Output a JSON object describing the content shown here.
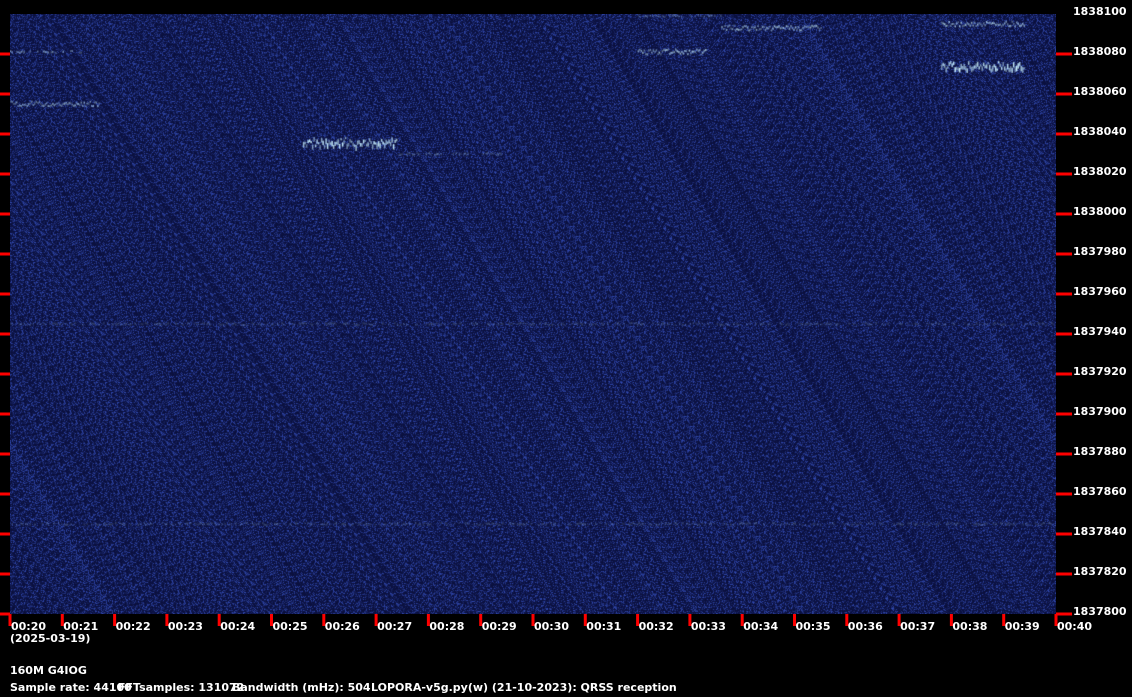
{
  "colors": {
    "background": "#000000",
    "plot_bg": "#0a0f3c",
    "tick_red": "#ff0000",
    "signal": "#c8f0ff"
  },
  "y_axis": {
    "unit": "Hz",
    "labels": [
      "1838100",
      "1838080",
      "1838060",
      "1838040",
      "1838020",
      "1838000",
      "1837980",
      "1837960",
      "1837940",
      "1837920",
      "1837900",
      "1837880",
      "1837860",
      "1837840",
      "1837820",
      "1837800"
    ]
  },
  "x_axis": {
    "labels": [
      "00:20",
      "00:21",
      "00:22",
      "00:23",
      "00:24",
      "00:25",
      "00:26",
      "00:27",
      "00:28",
      "00:29",
      "00:30",
      "00:31",
      "00:32",
      "00:33",
      "00:34",
      "00:35",
      "00:36",
      "00:37",
      "00:38",
      "00:39",
      "00:40"
    ]
  },
  "date": "(2025-03-19)",
  "station": "160M G4IOG",
  "info": {
    "sample_rate": "Sample rate: 44100",
    "fft_samples": "FFTsamples: 131072",
    "bandwidth": "Bandwidth (mHz): 504",
    "software": "LOPORA-v5g.py(w) (21-10-2023): QRSS reception"
  },
  "chart_data": {
    "type": "heatmap",
    "x_range": [
      "00:20",
      "00:40"
    ],
    "y_range": [
      1837800,
      1838100
    ],
    "traces": [
      {
        "t_start": "00:20.0",
        "t_end": "00:21.4",
        "f": 1838081,
        "strength": 0.45
      },
      {
        "t_start": "00:20.0",
        "t_end": "00:21.7",
        "f": 1838055,
        "strength": 0.55
      },
      {
        "t_start": "00:25.6",
        "t_end": "00:27.4",
        "f": 1838036,
        "strength": 0.9
      },
      {
        "t_start": "00:27.4",
        "t_end": "00:29.4",
        "f": 1838030,
        "strength": 0.3
      },
      {
        "t_start": "00:32.0",
        "t_end": "00:33.3",
        "f": 1838081,
        "strength": 0.7
      },
      {
        "t_start": "00:33.6",
        "t_end": "00:35.5",
        "f": 1838093,
        "strength": 0.65
      },
      {
        "t_start": "00:32.0",
        "t_end": "00:33.6",
        "f": 1838099,
        "strength": 0.3
      },
      {
        "t_start": "00:37.8",
        "t_end": "00:39.4",
        "f": 1838095,
        "strength": 0.7
      },
      {
        "t_start": "00:37.8",
        "t_end": "00:39.4",
        "f": 1838074,
        "strength": 1.0
      },
      {
        "t_start": "00:20.0",
        "t_end": "00:40.0",
        "f": 1837945,
        "strength": 0.2
      },
      {
        "t_start": "00:20.0",
        "t_end": "00:40.0",
        "f": 1837845,
        "strength": 0.2
      }
    ]
  }
}
